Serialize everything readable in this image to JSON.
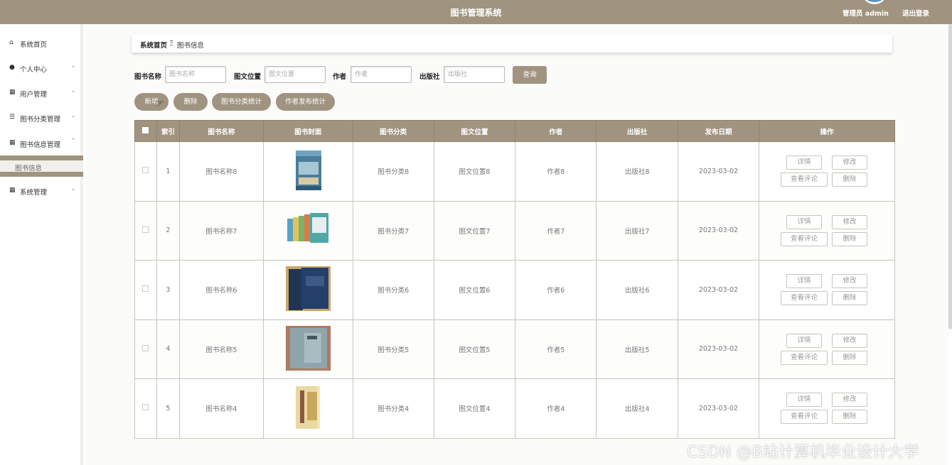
{
  "header": {
    "title": "图书管理系统",
    "user": "管理员 admin",
    "logout": "退出登录"
  },
  "sidebar": {
    "items": [
      {
        "label": "系统首页",
        "icon": "home-icon"
      },
      {
        "label": "个人中心",
        "icon": "user-icon"
      },
      {
        "label": "用户管理",
        "icon": "clipboard-icon"
      },
      {
        "label": "图书分类管理",
        "icon": "list-icon"
      },
      {
        "label": "图书信息管理",
        "icon": "grid-icon"
      },
      {
        "label": "系统管理",
        "icon": "grid-icon"
      }
    ],
    "sub_items": [
      {
        "label": "图书信息"
      }
    ]
  },
  "breadcrumb": {
    "home": "系统首页",
    "sep": "Ξ",
    "current": "图书信息"
  },
  "search": {
    "name_label": "图书名称",
    "name_placeholder": "图书名称",
    "position_label": "图文位置",
    "position_placeholder": "图文位置",
    "author_label": "作者",
    "author_placeholder": "作者",
    "publisher_label": "出版社",
    "publisher_placeholder": "出版社",
    "query_button": "查询"
  },
  "actions": {
    "add": "新增",
    "delete": "删除",
    "category_stats": "图书分类统计",
    "author_stats": "作者发布统计"
  },
  "table": {
    "headers": [
      "索引",
      "图书名称",
      "图书封面",
      "图书分类",
      "图文位置",
      "作者",
      "出版社",
      "发布日期",
      "操作"
    ],
    "rows": [
      {
        "index": "1",
        "name": "图书名称8",
        "category": "图书分类8",
        "position": "图文位置8",
        "author": "作者8",
        "publisher": "出版社8",
        "date": "2023-03-02"
      },
      {
        "index": "2",
        "name": "图书名称7",
        "category": "图书分类7",
        "position": "图文位置7",
        "author": "作者7",
        "publisher": "出版社7",
        "date": "2023-03-02"
      },
      {
        "index": "3",
        "name": "图书名称6",
        "category": "图书分类6",
        "position": "图文位置6",
        "author": "作者6",
        "publisher": "出版社6",
        "date": "2023-03-02"
      },
      {
        "index": "4",
        "name": "图书名称5",
        "category": "图书分类5",
        "position": "图文位置5",
        "author": "作者5",
        "publisher": "出版社5",
        "date": "2023-03-02"
      },
      {
        "index": "5",
        "name": "图书名称4",
        "category": "图书分类4",
        "position": "图文位置4",
        "author": "作者4",
        "publisher": "出版社4",
        "date": "2023-03-02"
      }
    ],
    "row_ops": {
      "detail": "详情",
      "edit": "修改",
      "comments": "查看评论",
      "delete": "删除"
    }
  },
  "watermark": "CSDN @B站计算机毕业设计大学",
  "colors": {
    "accent": "#a09480",
    "background": "#fbfbfa",
    "border": "#c9c5bd"
  }
}
